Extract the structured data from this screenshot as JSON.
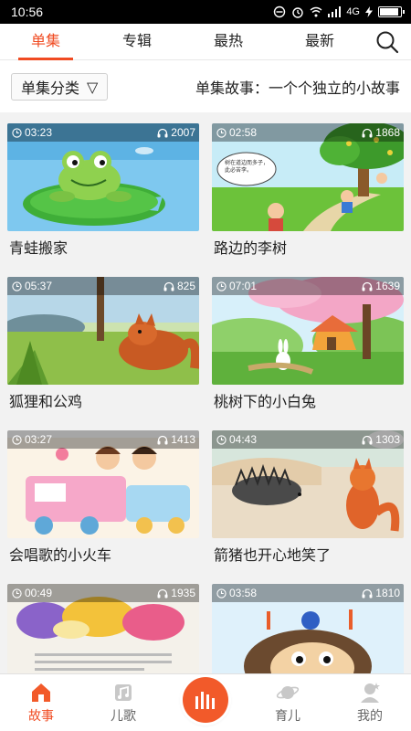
{
  "status": {
    "time": "10:56",
    "network": "4G"
  },
  "tabs": [
    {
      "label": "单集",
      "active": true
    },
    {
      "label": "专辑",
      "active": false
    },
    {
      "label": "最热",
      "active": false
    },
    {
      "label": "最新",
      "active": false
    }
  ],
  "filter": {
    "select_label": "单集分类",
    "arrow": "▽",
    "description": "单集故事：一个个独立的小故事"
  },
  "stories": [
    {
      "title": "青蛙搬家",
      "duration": "03:23",
      "plays": "2007"
    },
    {
      "title": "路边的李树",
      "duration": "02:58",
      "plays": "1868"
    },
    {
      "title": "狐狸和公鸡",
      "duration": "05:37",
      "plays": "825"
    },
    {
      "title": "桃树下的小白兔",
      "duration": "07:01",
      "plays": "1639"
    },
    {
      "title": "会唱歌的小火车",
      "duration": "03:27",
      "plays": "1413"
    },
    {
      "title": "箭猪也开心地笑了",
      "duration": "04:43",
      "plays": "1303"
    },
    {
      "title": "",
      "duration": "00:49",
      "plays": "1935"
    },
    {
      "title": "",
      "duration": "03:58",
      "plays": "1810"
    }
  ],
  "thumb_text": {
    "tree_sign": "树在道边而多子，此必苦李。"
  },
  "nav": [
    {
      "label": "故事",
      "icon": "home-icon",
      "active": true
    },
    {
      "label": "儿歌",
      "icon": "song-icon",
      "active": false
    },
    {
      "label": "育儿",
      "icon": "planet-icon",
      "active": false
    },
    {
      "label": "我的",
      "icon": "profile-icon",
      "active": false
    }
  ],
  "colors": {
    "accent": "#f04b22",
    "center_button": "#f25a2a"
  }
}
